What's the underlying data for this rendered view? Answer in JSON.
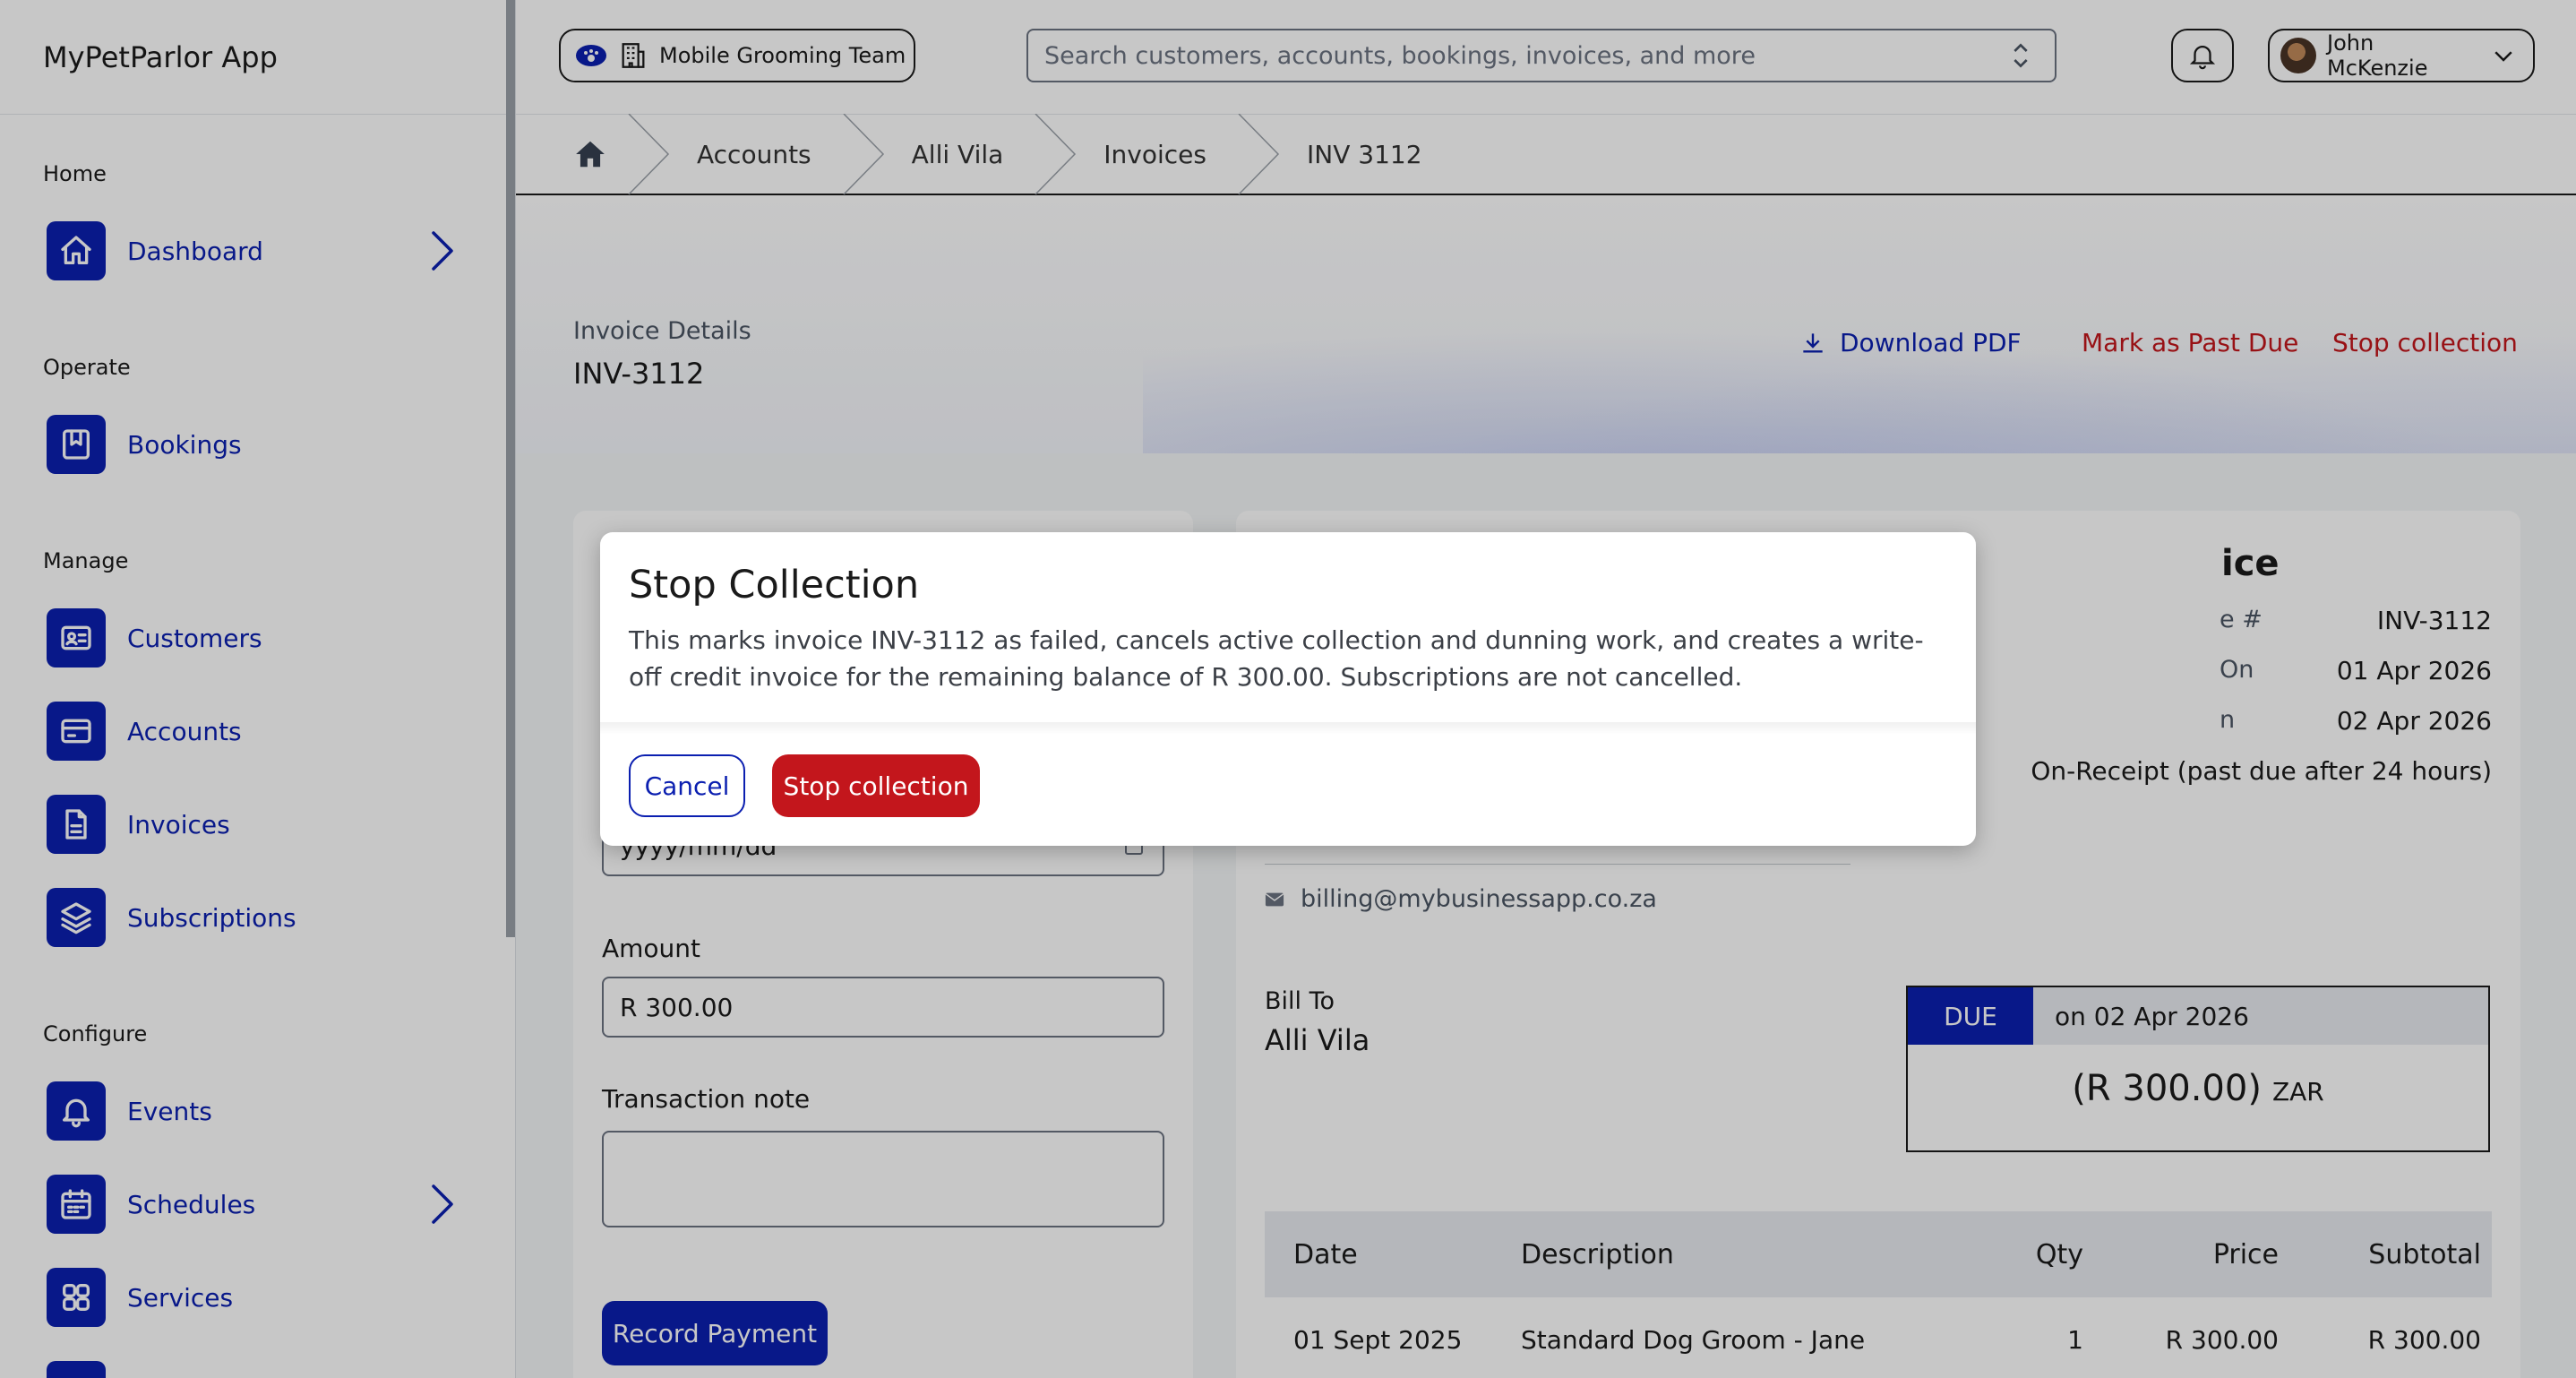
{
  "app": {
    "title": "MyPetParlor App"
  },
  "sidebar": {
    "sections": {
      "home": "Home",
      "operate": "Operate",
      "manage": "Manage",
      "configure": "Configure"
    },
    "items": {
      "dashboard": "Dashboard",
      "bookings": "Bookings",
      "customers": "Customers",
      "accounts": "Accounts",
      "invoices": "Invoices",
      "subscriptions": "Subscriptions",
      "events": "Events",
      "schedules": "Schedules",
      "services": "Services"
    }
  },
  "topbar": {
    "team": "Mobile Grooming Team",
    "search_placeholder": "Search customers, accounts, bookings, invoices, and more",
    "user": "John McKenzie"
  },
  "breadcrumb": [
    "Accounts",
    "Alli Vila",
    "Invoices",
    "INV 3112"
  ],
  "header": {
    "subtitle": "Invoice Details",
    "title": "INV-3112",
    "download": "Download PDF",
    "mark_past_due": "Mark as Past Due",
    "stop_collection": "Stop collection"
  },
  "payment_form": {
    "date_placeholder": "yyyy/mm/dd",
    "amount_label": "Amount",
    "amount_value": "R 300.00",
    "note_label": "Transaction note",
    "record_button": "Record Payment"
  },
  "invoice": {
    "title_fragment": "ice",
    "rows": [
      {
        "label": "e #",
        "value": "INV-3112"
      },
      {
        "label": "On",
        "value": "01 Apr 2026"
      },
      {
        "label": "n",
        "value": "02 Apr 2026"
      },
      {
        "label": "",
        "value": "On-Receipt (past due after 24 hours)"
      }
    ],
    "email": "billing@mybusinessapp.co.za",
    "bill_to_label": "Bill To",
    "bill_to_name": "Alli Vila",
    "due_tag": "DUE",
    "due_date": "on 02 Apr 2026",
    "due_amount": "(R 300.00)",
    "currency": "ZAR",
    "table": {
      "headers": [
        "Date",
        "Description",
        "Qty",
        "Price",
        "Subtotal"
      ],
      "rows": [
        [
          "01 Sept 2025",
          "Standard Dog Groom - Jane",
          "1",
          "R 300.00",
          "R 300.00"
        ]
      ]
    }
  },
  "modal": {
    "title": "Stop Collection",
    "body": "This marks invoice INV-3112 as failed, cancels active collection and dunning work, and creates a write-off credit invoice for the remaining balance of R 300.00. Subscriptions are not cancelled.",
    "cancel": "Cancel",
    "confirm": "Stop collection"
  },
  "colors": {
    "brand": "#0b1fb0",
    "danger": "#c3161c"
  }
}
